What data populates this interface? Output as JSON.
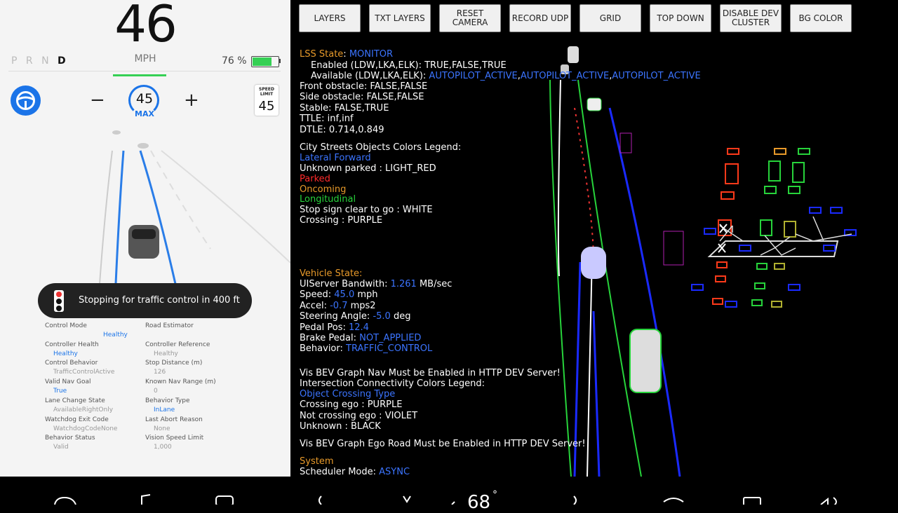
{
  "left": {
    "speed": "46",
    "speed_unit": "MPH",
    "gears_inactive": "P R N",
    "gear_active": "D",
    "battery_text": "76 %",
    "battery_level": 0.76,
    "set_speed": "45",
    "set_speed_label": "MAX",
    "minus": "−",
    "plus": "+",
    "speed_limit_label": "SPEED LIMIT",
    "speed_limit": "45",
    "toast": "Stopping for traffic control in 400 ft",
    "status": [
      {
        "label": "Control Mode",
        "value": "Healthy",
        "value_blue": true
      },
      {
        "label": "Road Estimator",
        "value": "",
        "value_blue": false
      },
      {
        "label": "Controller Health",
        "value": "Healthy",
        "value_blue": true
      },
      {
        "label": "Controller Reference",
        "value": "Healthy",
        "value_blue": false
      },
      {
        "label": "Control Behavior",
        "value": "TrafficControlActive",
        "value_blue": false
      },
      {
        "label": "Stop Distance (m)",
        "value": "126",
        "value_blue": false
      },
      {
        "label": "Valid Nav Goal",
        "value": "True",
        "value_blue": true
      },
      {
        "label": "Known Nav Range (m)",
        "value": "0",
        "value_blue": false
      },
      {
        "label": "Lane Change State",
        "value": "AvailableRightOnly",
        "value_blue": false
      },
      {
        "label": "Behavior Type",
        "value": "InLane",
        "value_blue": true
      },
      {
        "label": "Watchdog Exit Code",
        "value": "WatchdogCodeNone",
        "value_blue": false
      },
      {
        "label": "Last Abort Reason",
        "value": "None",
        "value_blue": false
      },
      {
        "label": "Behavior Status",
        "value": "Valid",
        "value_blue": false
      },
      {
        "label": "Vision Speed Limit",
        "value": "1,000",
        "value_blue": false
      }
    ]
  },
  "toolbar": [
    {
      "label": "LAYERS"
    },
    {
      "label": "TXT LAYERS"
    },
    {
      "label": "RESET CAMERA"
    },
    {
      "label": "RECORD UDP"
    },
    {
      "label": "GRID"
    },
    {
      "label": "TOP DOWN"
    },
    {
      "label": "DISABLE DEV CLUSTER"
    },
    {
      "label": "BG COLOR"
    }
  ],
  "debug": {
    "lss_label": "LSS State",
    "lss_value": "MONITOR",
    "enabled": "Enabled (LDW,LKA,ELK): TRUE,FALSE,TRUE",
    "available_label": "Available (LDW,LKA,ELK): ",
    "available_values": [
      "AUTOPILOT_ACTIVE",
      "AUTOPILOT_ACTIVE",
      "AUTOPILOT_ACTIVE"
    ],
    "front_obstacle": "Front obstacle: FALSE,FALSE",
    "side_obstacle": "Side obstacle: FALSE,FALSE",
    "stable": "Stable: FALSE,TRUE",
    "ttle": "TTLE: inf,inf",
    "dtle": "DTLE: 0.714,0.849",
    "legend_title": "City Streets Objects Colors Legend:",
    "legend": {
      "lateral_forward": "Lateral Forward",
      "unknown_parked": "Unknown parked : LIGHT_RED",
      "parked": "Parked",
      "oncoming": "Oncoming",
      "longitudinal": "Longitudinal",
      "stop_sign": "Stop sign clear to go : WHITE",
      "crossing": "Crossing : PURPLE"
    },
    "vehicle_state_label": "Vehicle State:",
    "uiserver_label": "UIServer Bandwith:",
    "uiserver_value": "1.261",
    "uiserver_unit": "MB/sec",
    "speed_label": "Speed:",
    "speed_value": "45.0",
    "speed_unit": "mph",
    "accel_label": "Accel:",
    "accel_value": "-0.7",
    "accel_unit": "mps2",
    "steering_label": "Steering Angle:",
    "steering_value": "-5.0",
    "steering_unit": "deg",
    "pedal_label": "Pedal Pos:",
    "pedal_value": "12.4",
    "brake_label": "Brake Pedal:",
    "brake_value": "NOT_APPLIED",
    "behavior_label": "Behavior:",
    "behavior_value": "TRAFFIC_CONTROL",
    "vis_bev_nav": "Vis BEV Graph Nav Must be Enabled in HTTP DEV Server!",
    "intersection_legend": "Intersection Connectivity Colors Legend:",
    "object_crossing": "Object Crossing Type",
    "crossing_ego": "Crossing ego : PURPLE",
    "not_crossing_ego": "Not crossing ego : VIOLET",
    "unknown_black": "Unknown : BLACK",
    "vis_bev_ego": "Vis BEV Graph Ego Road Must be Enabled in HTTP DEV Server!",
    "system_label": "System",
    "scheduler_label": "Scheduler Mode:",
    "scheduler_value": "ASYNC"
  },
  "taskbar": {
    "temperature": "68"
  },
  "colors": {
    "accent_blue": "#1b74e8",
    "debug_blue": "#3b74ff",
    "green": "#27d33b",
    "orange": "#e89a2a",
    "red": "#ff2a2a"
  }
}
